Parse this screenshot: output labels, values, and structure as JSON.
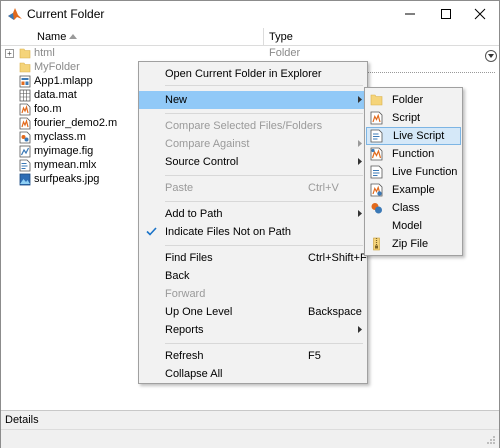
{
  "window": {
    "title": "Current Folder"
  },
  "columns": {
    "name": "Name",
    "type": "Type"
  },
  "files": [
    {
      "name": "html",
      "type": "Folder",
      "icon": "folder-icon",
      "expandable": true,
      "greyed": true
    },
    {
      "name": "MyFolder",
      "type": "",
      "icon": "folder-icon",
      "expandable": false,
      "greyed": true
    },
    {
      "name": "App1.mlapp",
      "type": "",
      "icon": "mlapp-file-icon"
    },
    {
      "name": "data.mat",
      "type": "",
      "icon": "mat-file-icon"
    },
    {
      "name": "foo.m",
      "type": "",
      "icon": "m-file-icon"
    },
    {
      "name": "fourier_demo2.m",
      "type": "",
      "icon": "m-file-icon"
    },
    {
      "name": "myclass.m",
      "type": "",
      "icon": "class-file-icon"
    },
    {
      "name": "myimage.fig",
      "type": "",
      "icon": "fig-file-icon"
    },
    {
      "name": "mymean.mlx",
      "type": "",
      "icon": "mlx-file-icon"
    },
    {
      "name": "surfpeaks.jpg",
      "type": "",
      "icon": "jpg-file-icon"
    }
  ],
  "context_menu": {
    "items": [
      {
        "label": "Open Current Folder in Explorer"
      },
      {
        "label": "New",
        "submenu": true,
        "highlighted": true
      },
      {
        "label": "Compare Selected Files/Folders",
        "disabled": true
      },
      {
        "label": "Compare Against",
        "disabled": true,
        "submenu": true
      },
      {
        "label": "Source Control",
        "submenu": true
      },
      {
        "label": "Paste",
        "shortcut": "Ctrl+V",
        "disabled": true
      },
      {
        "label": "Add to Path",
        "submenu": true
      },
      {
        "label": "Indicate Files Not on Path",
        "checked": true
      },
      {
        "label": "Find Files",
        "shortcut": "Ctrl+Shift+F"
      },
      {
        "label": "Back"
      },
      {
        "label": "Forward",
        "disabled": true
      },
      {
        "label": "Up One Level",
        "shortcut": "Backspace"
      },
      {
        "label": "Reports",
        "submenu": true
      },
      {
        "label": "Refresh",
        "shortcut": "F5"
      },
      {
        "label": "Collapse All"
      }
    ]
  },
  "new_submenu": {
    "items": [
      {
        "label": "Folder",
        "icon": "folder-icon"
      },
      {
        "label": "Script",
        "icon": "script-icon"
      },
      {
        "label": "Live Script",
        "icon": "live-script-icon",
        "highlighted": true
      },
      {
        "label": "Function",
        "icon": "function-icon"
      },
      {
        "label": "Live Function",
        "icon": "live-function-icon"
      },
      {
        "label": "Example",
        "icon": "example-icon"
      },
      {
        "label": "Class",
        "icon": "class-icon"
      },
      {
        "label": "Model",
        "icon": "model-icon"
      },
      {
        "label": "Zip File",
        "icon": "zip-file-icon"
      }
    ]
  },
  "details": {
    "label": "Details"
  },
  "colors": {
    "menu_highlight": "#91c9f7",
    "submenu_highlight": "#d5e8f8",
    "folder": "#f5d47a",
    "matlab_orange": "#e26a1d",
    "check": "#1a73c8"
  }
}
